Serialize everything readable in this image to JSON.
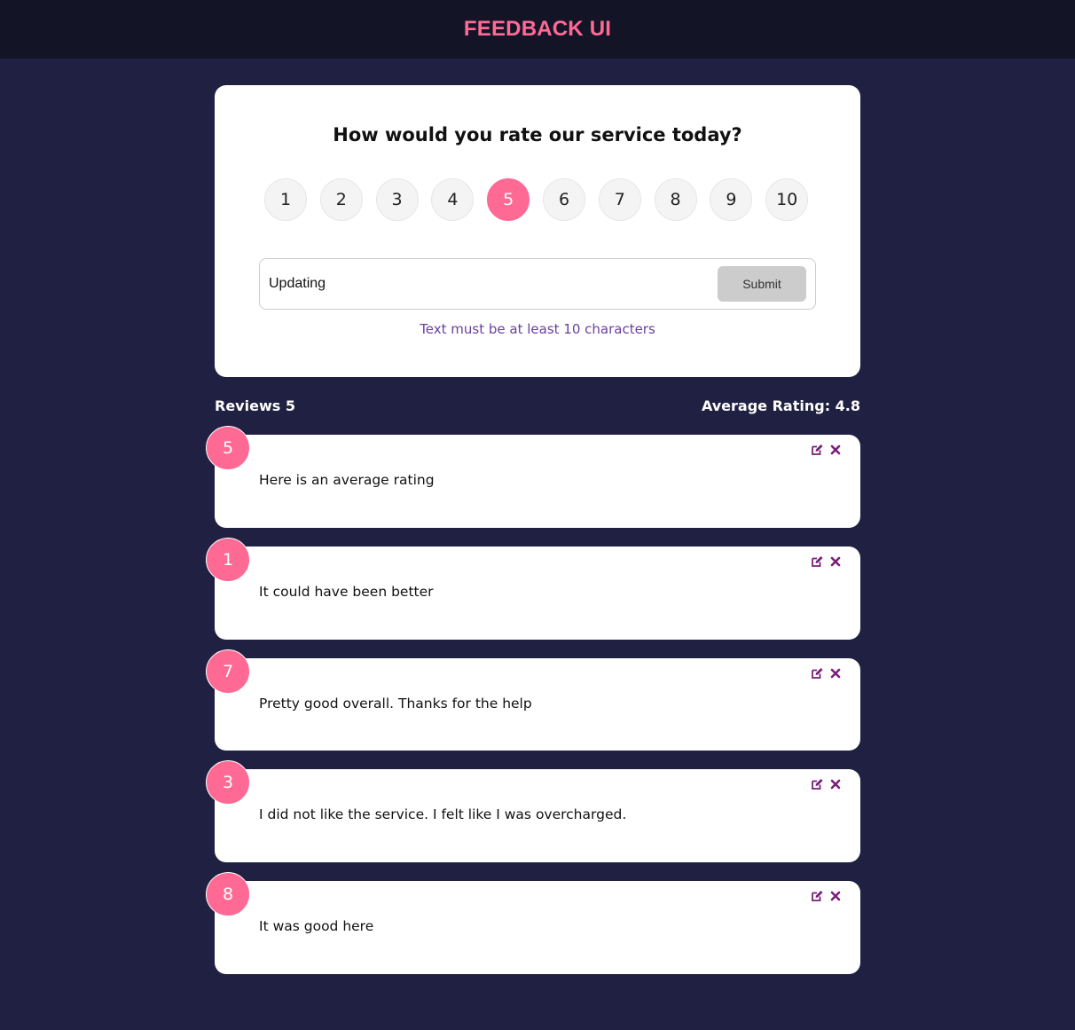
{
  "header": {
    "title": "FEEDBACK UI"
  },
  "form": {
    "question": "How would you rate our service today?",
    "ratings": [
      "1",
      "2",
      "3",
      "4",
      "5",
      "6",
      "7",
      "8",
      "9",
      "10"
    ],
    "selected_rating": "5",
    "input_value": "Updating",
    "submit_label": "Submit",
    "validation_message": "Text must be at least 10 characters"
  },
  "stats": {
    "reviews_label": "Reviews 5",
    "average_label": "Average Rating: 4.8"
  },
  "feedback": [
    {
      "rating": "5",
      "text": "Here is an average rating"
    },
    {
      "rating": "1",
      "text": "It could have been better"
    },
    {
      "rating": "7",
      "text": "Pretty good overall. Thanks for the help"
    },
    {
      "rating": "3",
      "text": "I did not like the service. I felt like I was overcharged."
    },
    {
      "rating": "8",
      "text": "It was good here"
    }
  ],
  "icons": {
    "edit": "edit-icon",
    "delete": "close-icon"
  },
  "colors": {
    "background": "#202142",
    "header": "#131527",
    "accent": "#ff6a95",
    "action": "#7a1f7a",
    "validation": "#6b3fa0"
  }
}
